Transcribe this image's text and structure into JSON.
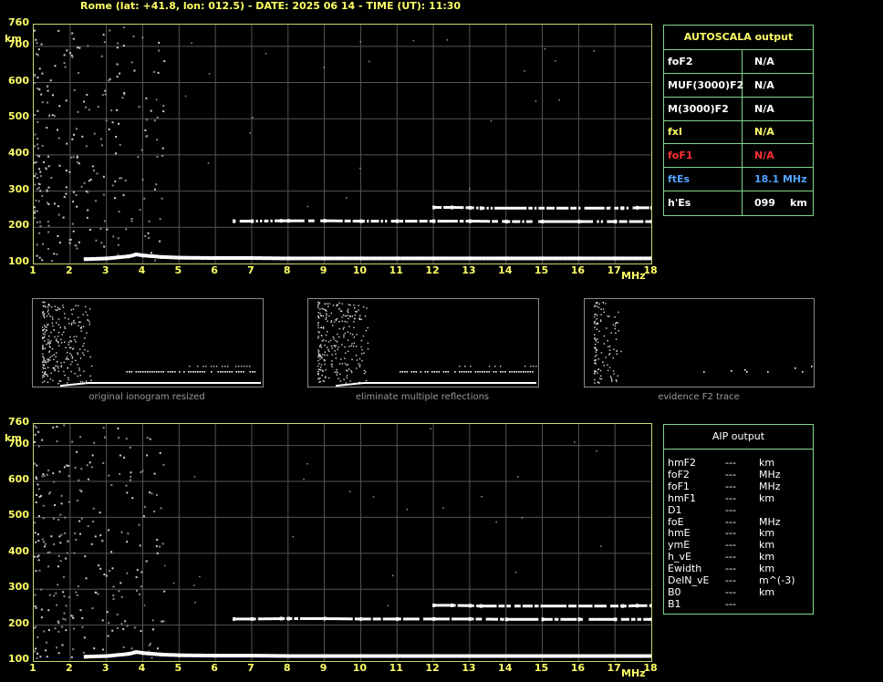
{
  "header": "Rome (lat: +41.8, lon: 012.5) - DATE: 2025 06 14 - TIME (UT): 11:30",
  "axes": {
    "y_unit": "km",
    "x_unit": "MHz",
    "y_ticks": [
      "760",
      "700",
      "600",
      "500",
      "400",
      "300",
      "200",
      "100"
    ],
    "x_ticks": [
      "1",
      "2",
      "3",
      "4",
      "5",
      "6",
      "7",
      "8",
      "9",
      "10",
      "11",
      "12",
      "13",
      "14",
      "15",
      "16",
      "17",
      "18"
    ]
  },
  "autoscala": {
    "title": "AUTOSCALA output",
    "rows": [
      {
        "key": "foF2",
        "value": "N/A",
        "unit": "",
        "color": "#ffffff"
      },
      {
        "key": "MUF(3000)F2",
        "value": "N/A",
        "unit": "",
        "color": "#ffffff"
      },
      {
        "key": "M(3000)F2",
        "value": "N/A",
        "unit": "",
        "color": "#ffffff"
      },
      {
        "key": "fxI",
        "value": "N/A",
        "unit": "",
        "color": "#ffff66"
      },
      {
        "key": "foF1",
        "value": "N/A",
        "unit": "",
        "color": "#ff3030"
      },
      {
        "key": "ftEs",
        "value": "18.1  MHz",
        "unit": "",
        "color": "#4fa3ff"
      },
      {
        "key": "h'Es",
        "value": "099",
        "unit": "km",
        "color": "#ffffff"
      }
    ]
  },
  "thumbnails": [
    {
      "caption": "original ionogram resized"
    },
    {
      "caption": "eliminate multiple reflections"
    },
    {
      "caption": "evidence F2 trace"
    }
  ],
  "aip": {
    "title": "AIP output",
    "rows": [
      {
        "k": "hmF2",
        "v": "---",
        "u": "km"
      },
      {
        "k": "foF2",
        "v": "---",
        "u": "MHz"
      },
      {
        "k": "foF1",
        "v": "---",
        "u": "MHz"
      },
      {
        "k": "hmF1",
        "v": "---",
        "u": "km"
      },
      {
        "k": "D1",
        "v": "---",
        "u": ""
      },
      {
        "k": "foE",
        "v": "---",
        "u": "MHz"
      },
      {
        "k": "hmE",
        "v": "---",
        "u": "km"
      },
      {
        "k": "ymE",
        "v": "---",
        "u": "km"
      },
      {
        "k": "h_vE",
        "v": "---",
        "u": "km"
      },
      {
        "k": "Ewidth",
        "v": "---",
        "u": "km"
      },
      {
        "k": "DelN_vE",
        "v": "---",
        "u": "m^(-3)"
      },
      {
        "k": "B0",
        "v": "---",
        "u": "km"
      },
      {
        "k": "B1",
        "v": "---",
        "u": ""
      }
    ]
  },
  "chart_data": [
    {
      "type": "scatter",
      "title": "",
      "xlabel": "MHz",
      "ylabel": "km",
      "xlim": [
        1,
        18
      ],
      "ylim": [
        100,
        760
      ],
      "grid": true,
      "series": [
        {
          "x": [
            2.4,
            3.0,
            3.6,
            3.8,
            4.0,
            4.5,
            5.0,
            6.0,
            7.0,
            8.0,
            9.0,
            10.0,
            11.0,
            12.0,
            13.0,
            14.0,
            15.0,
            16.0,
            17.0,
            18.0
          ],
          "y": [
            112,
            114,
            120,
            125,
            122,
            118,
            116,
            115,
            115,
            114,
            114,
            114,
            114,
            114,
            114,
            114,
            114,
            114,
            114,
            114
          ]
        },
        {
          "x": [
            6.5,
            7.0,
            7.8,
            8.0,
            9.0,
            10.0,
            11.0,
            12.0,
            13.0,
            14.0,
            15.0,
            16.0,
            17.0,
            18.0
          ],
          "y": [
            217,
            217,
            218,
            218,
            218,
            217,
            217,
            217,
            217,
            216,
            216,
            216,
            216,
            216
          ]
        },
        {
          "x": [
            12.0,
            12.5,
            13.0,
            13.3,
            17.2,
            17.6,
            18.0
          ],
          "y": [
            255,
            255,
            254,
            253,
            253,
            254,
            254
          ]
        }
      ]
    },
    {
      "type": "scatter",
      "title": "",
      "xlabel": "MHz",
      "ylabel": "km",
      "xlim": [
        1,
        18
      ],
      "ylim": [
        100,
        760
      ],
      "grid": true,
      "series": [
        {
          "x": [
            2.4,
            3.0,
            3.6,
            3.8,
            4.0,
            4.5,
            5.0,
            6.0,
            7.0,
            8.0,
            9.0,
            10.0,
            11.0,
            12.0,
            13.0,
            14.0,
            15.0,
            16.0,
            17.0,
            18.0
          ],
          "y": [
            112,
            114,
            120,
            125,
            122,
            118,
            116,
            115,
            115,
            114,
            114,
            114,
            114,
            114,
            114,
            114,
            114,
            114,
            114,
            114
          ]
        },
        {
          "x": [
            6.5,
            7.0,
            7.8,
            8.0,
            9.0,
            10.0,
            11.0,
            12.0,
            13.0,
            14.0,
            15.0,
            16.0,
            17.0,
            18.0
          ],
          "y": [
            217,
            217,
            218,
            218,
            218,
            217,
            217,
            217,
            217,
            216,
            216,
            216,
            216,
            216
          ]
        },
        {
          "x": [
            12.0,
            12.5,
            13.0,
            13.3,
            17.2,
            17.6,
            18.0
          ],
          "y": [
            255,
            255,
            254,
            253,
            253,
            254,
            254
          ]
        }
      ]
    }
  ]
}
